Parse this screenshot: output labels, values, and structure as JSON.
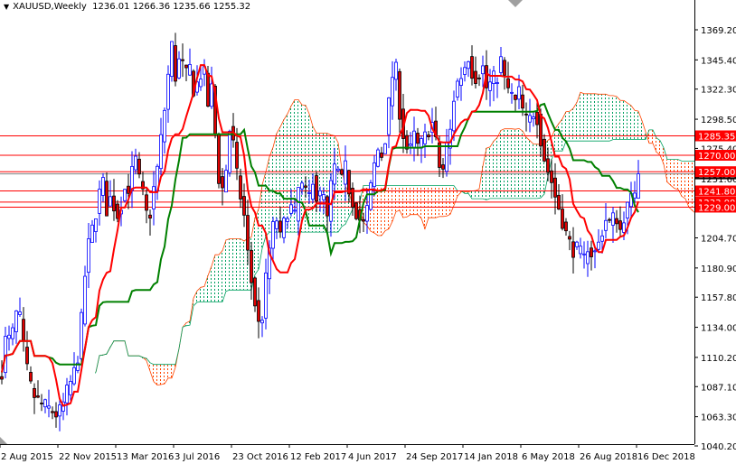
{
  "header": {
    "symbol": "XAUUSD,Weekly",
    "ohlc": "1236.01 1266.36 1235.66 1255.32"
  },
  "chart_data": {
    "type": "candlestick",
    "title": "XAUUSD,Weekly",
    "indicator": "Ichimoku Kinko Hyo (9,26,52)",
    "ylim": [
      1040.2,
      1369.2
    ],
    "y_ticks": [
      "1369.20",
      "1345.40",
      "1322.30",
      "1298.50",
      "1275.40",
      "1251.60",
      "1228.00",
      "1204.70",
      "1180.90",
      "1157.80",
      "1134.00",
      "1110.20",
      "1087.10",
      "1063.30",
      "1040.20"
    ],
    "x_ticks": [
      "2 Aug 2015",
      "22 Nov 2015",
      "13 Mar 2016",
      "3 Jul 2016",
      "23 Oct 2016",
      "12 Feb 2017",
      "4 Jun 2017",
      "24 Sep 2017",
      "14 Jan 2018",
      "6 May 2018",
      "26 Aug 2018",
      "16 Dec 2018"
    ],
    "weeks_per_x_tick": 16,
    "n_weeks": 177,
    "approx_closes": [
      1100,
      1130,
      1120,
      1145,
      1140,
      1110,
      1090,
      1080,
      1075,
      1072,
      1070,
      1068,
      1065,
      1068,
      1080,
      1090,
      1100,
      1120,
      1170,
      1200,
      1215,
      1235,
      1250,
      1225,
      1240,
      1220,
      1232,
      1245,
      1245,
      1270,
      1250,
      1235,
      1215,
      1240,
      1260,
      1290,
      1320,
      1360,
      1330,
      1350,
      1330,
      1340,
      1320,
      1330,
      1340,
      1310,
      1325,
      1260,
      1240,
      1260,
      1300,
      1260,
      1240,
      1220,
      1180,
      1160,
      1135,
      1145,
      1185,
      1210,
      1220,
      1200,
      1225,
      1230,
      1220,
      1250,
      1240,
      1235,
      1255,
      1230,
      1245,
      1215,
      1250,
      1265,
      1245,
      1260,
      1240,
      1230,
      1220,
      1215,
      1230,
      1255,
      1275,
      1270,
      1290,
      1330,
      1340,
      1300,
      1280,
      1270,
      1285,
      1275,
      1280,
      1290,
      1295,
      1275,
      1250,
      1275,
      1290,
      1325,
      1330,
      1340,
      1350,
      1330,
      1335,
      1340,
      1320,
      1330,
      1330,
      1345,
      1325,
      1320,
      1310,
      1320,
      1300,
      1295,
      1305,
      1300,
      1275,
      1260,
      1250,
      1235,
      1225,
      1210,
      1200,
      1195,
      1195,
      1185,
      1200,
      1190,
      1195,
      1210,
      1220,
      1215,
      1225,
      1210,
      1225,
      1230,
      1240,
      1255.32
    ],
    "last_candle": {
      "open": 1236.01,
      "high": 1266.36,
      "low": 1235.66,
      "close": 1255.32
    },
    "colors": {
      "bull": "#0000ff",
      "bear_body": "#e00000",
      "tenkan": "#ff0000",
      "kijun": "#008000",
      "cloud_bear": "#ff4500",
      "cloud_bull": "#00a060",
      "levels": "#ff0000",
      "bid": "#808080"
    },
    "levels": [
      {
        "value": 1285.35,
        "label": "1285.35"
      },
      {
        "value": 1270.0,
        "label": "1270.00"
      },
      {
        "value": 1257.0,
        "label": "1257.00"
      },
      {
        "value": 1241.8,
        "label": "1241.80"
      },
      {
        "value": 1233.0,
        "label": "1233.00"
      },
      {
        "value": 1229.0,
        "label": "1229.00"
      }
    ],
    "bid": {
      "value": 1255.32,
      "label": "1255.32"
    }
  }
}
